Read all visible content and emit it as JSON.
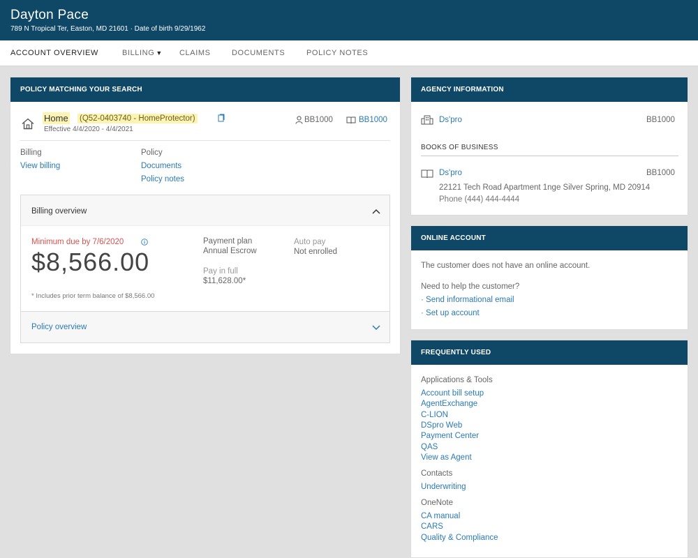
{
  "header": {
    "customer_name": "Dayton Pace",
    "customer_details": "789 N Tropical Ter, Easton, MD 21601 · Date of birth 9/29/1962"
  },
  "nav": {
    "items": [
      {
        "label": "ACCOUNT OVERVIEW"
      },
      {
        "label": "BILLING"
      },
      {
        "label": "CLAIMS"
      },
      {
        "label": "DOCUMENTS"
      },
      {
        "label": "POLICY NOTES"
      }
    ]
  },
  "policy_panel": {
    "title": "POLICY MATCHING YOUR SEARCH",
    "policy_type": "Home",
    "policy_id": "(Q52-0403740 - HomeProtector)",
    "effective": "Effective 4/4/2020 - 4/4/2021",
    "agent_code": "BB1000",
    "book_code": "BB1000",
    "billing_heading": "Billing",
    "billing_link": "View billing",
    "policy_heading": "Policy",
    "documents_link": "Documents",
    "policy_notes_link": "Policy notes",
    "billing_overview": {
      "title": "Billing overview",
      "minimum_due_label": "Minimum due by 7/6/2020",
      "amount": "$8,566.00",
      "footnote": "* Includes prior term balance of $8,566.00",
      "payment_plan_label": "Payment plan",
      "payment_plan_value": "Annual Escrow",
      "pay_in_full_label": "Pay in full",
      "pay_in_full_value": "$11,628.00*",
      "auto_pay_label": "Auto pay",
      "auto_pay_value": "Not enrolled"
    },
    "policy_overview_title": "Policy overview"
  },
  "agency_panel": {
    "title": "AGENCY INFORMATION",
    "agency_name": "Ds'pro",
    "agency_code": "BB1000",
    "books_heading": "BOOKS OF BUSINESS",
    "book_name": "Ds'pro",
    "book_code": "BB1000",
    "book_address": "22121 Tech Road Apartment 1nge  Silver Spring, MD 20914",
    "book_phone": "Phone (444) 444-4444"
  },
  "online_panel": {
    "title": "ONLINE ACCOUNT",
    "status_text": "The customer does not have an online account.",
    "help_text": "Need to help the customer?",
    "links": [
      "· Send informational email",
      "· Set up account"
    ]
  },
  "frequent_panel": {
    "title": "FREQUENTLY USED",
    "groups": [
      {
        "heading": "Applications & Tools",
        "links": [
          "Account bill setup",
          "AgentExchange",
          "C-LION",
          "DSpro Web",
          "Payment Center",
          "QAS",
          "View as Agent"
        ]
      },
      {
        "heading": "Contacts",
        "links": [
          "Underwriting"
        ]
      },
      {
        "heading": "OneNote",
        "links": [
          "CA manual",
          "CARS",
          "Quality & Compliance"
        ]
      }
    ]
  },
  "colors": {
    "header_bg": "#0f4767",
    "link": "#2a7ab8",
    "alert": "#d9534f",
    "highlight": "#fdf3b3"
  },
  "icons": [
    "home-icon",
    "copy-icon",
    "agent-icon",
    "book-icon",
    "info-icon",
    "chevron-up-icon",
    "chevron-down-icon",
    "building-icon"
  ]
}
